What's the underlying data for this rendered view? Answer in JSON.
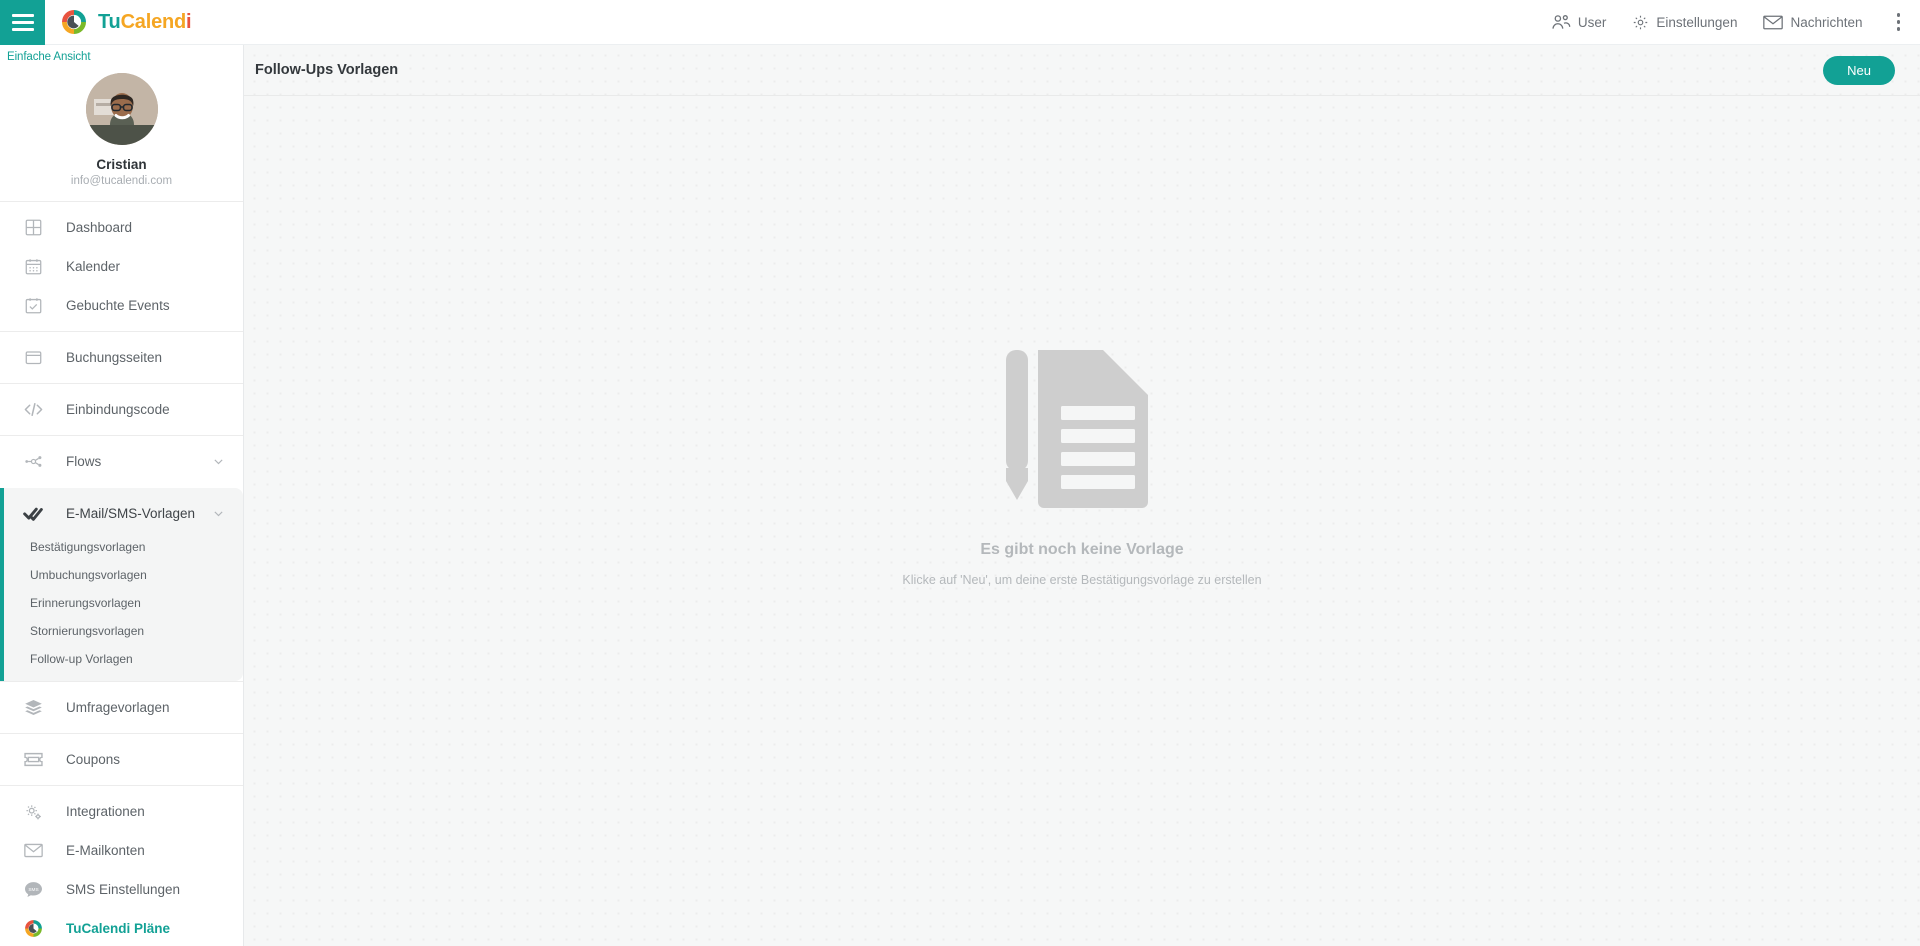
{
  "topbar": {
    "menu_icon": "hamburger-icon",
    "brand": {
      "part1": "Tu",
      "part2": "Calend",
      "part3": "i"
    },
    "items": [
      {
        "label": "User",
        "icon": "users-icon"
      },
      {
        "label": "Einstellungen",
        "icon": "gear-icon"
      },
      {
        "label": "Nachrichten",
        "icon": "envelope-icon"
      }
    ],
    "overflow_icon": "kebab-menu-icon"
  },
  "sidebar": {
    "simple_view": "Einfache Ansicht",
    "profile": {
      "name": "Cristian",
      "email": "info@tucalendi.com",
      "avatar_icon": "user-avatar-photo"
    },
    "groups": [
      {
        "items": [
          {
            "label": "Dashboard",
            "icon": "grid-icon"
          },
          {
            "label": "Kalender",
            "icon": "calendar-icon"
          },
          {
            "label": "Gebuchte Events",
            "icon": "calendar-check-icon"
          }
        ]
      },
      {
        "items": [
          {
            "label": "Buchungsseiten",
            "icon": "browser-window-icon"
          }
        ]
      },
      {
        "items": [
          {
            "label": "Einbindungscode",
            "icon": "code-brackets-icon"
          }
        ]
      },
      {
        "items": [
          {
            "label": "Flows",
            "icon": "nodes-icon",
            "chevron": "chevron-down-icon"
          }
        ]
      }
    ],
    "active_group": {
      "label": "E-Mail/SMS-Vorlagen",
      "icon": "double-check-icon",
      "chevron": "chevron-down-icon",
      "subitems": [
        "Bestätigungsvorlagen",
        "Umbuchungsvorlagen",
        "Erinnerungsvorlagen",
        "Stornierungsvorlagen",
        "Follow-up Vorlagen"
      ]
    },
    "groups_after": [
      {
        "items": [
          {
            "label": "Umfragevorlagen",
            "icon": "layers-icon"
          }
        ]
      },
      {
        "items": [
          {
            "label": "Coupons",
            "icon": "ticket-icon"
          }
        ]
      },
      {
        "items": [
          {
            "label": "Integrationen",
            "icon": "gears-icon"
          },
          {
            "label": "E-Mailkonten",
            "icon": "envelope-icon"
          },
          {
            "label": "SMS Einstellungen",
            "icon": "sms-bubble-icon"
          },
          {
            "label": "TuCalendi Pläne",
            "icon": "tucalendi-logo-icon",
            "accent": true
          }
        ]
      }
    ]
  },
  "main": {
    "title": "Follow-Ups Vorlagen",
    "new_button": "Neu",
    "empty_state": {
      "illustration": "document-with-pen-icon",
      "title": "Es gibt noch keine Vorlage",
      "subtitle": "Klicke auf 'Neu', um deine erste Bestätigungsvorlage zu erstellen"
    }
  },
  "colors": {
    "accent": "#12a195",
    "brand_orange": "#f5a623",
    "brand_red": "#e8533f",
    "text": "#5d6368",
    "muted": "#b4b8bb"
  }
}
